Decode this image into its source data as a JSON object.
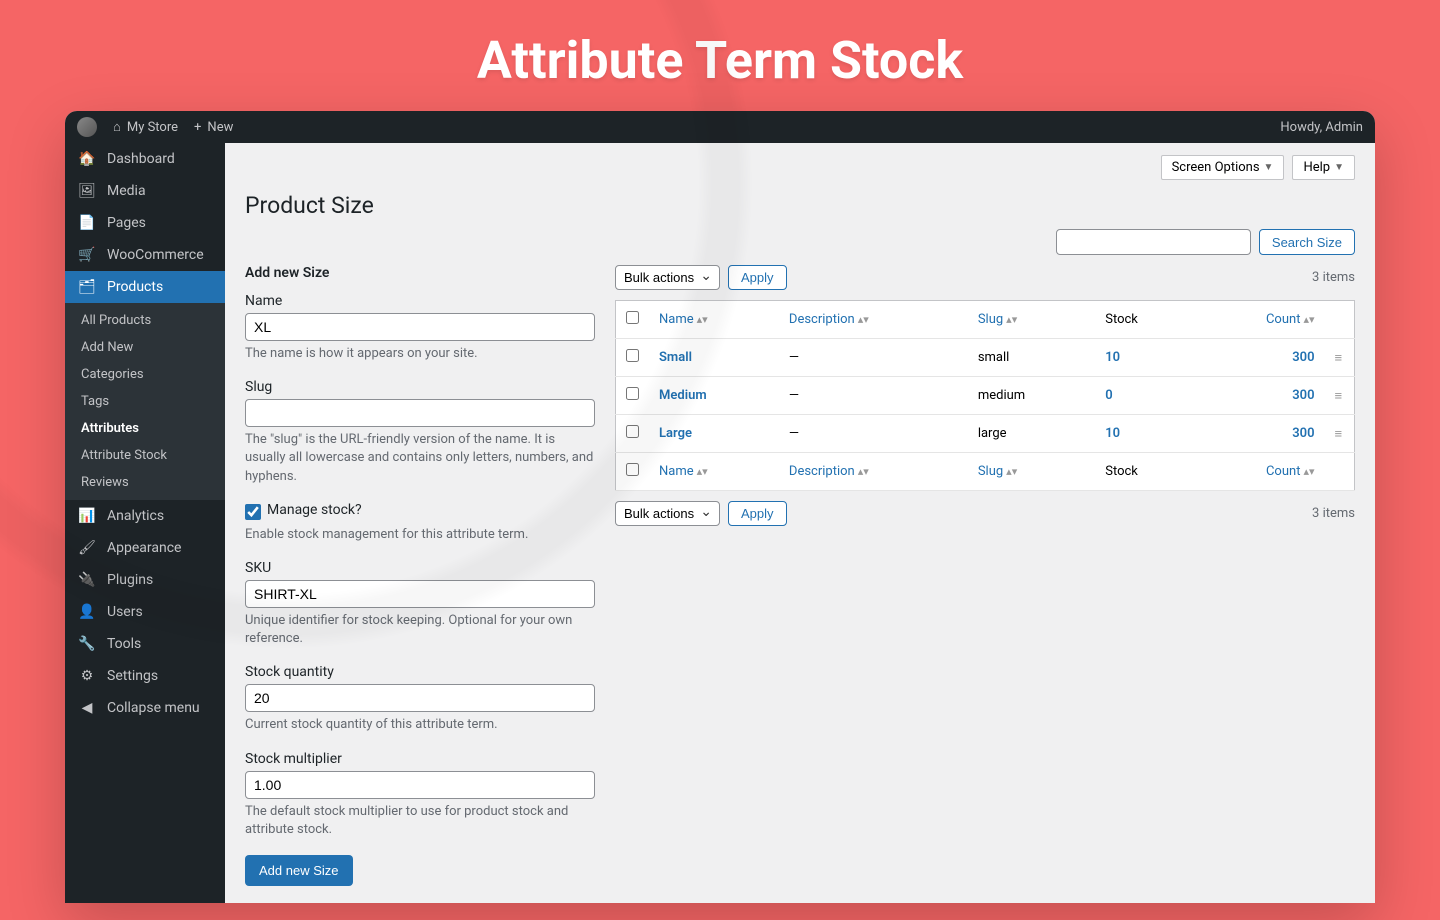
{
  "hero": "Attribute Term Stock",
  "toolbar": {
    "site": "My Store",
    "new": "New",
    "howdy": "Howdy, Admin"
  },
  "sidebar": {
    "items": [
      {
        "label": "Dashboard"
      },
      {
        "label": "Media"
      },
      {
        "label": "Pages"
      },
      {
        "label": "WooCommerce"
      },
      {
        "label": "Products"
      },
      {
        "label": "Analytics"
      },
      {
        "label": "Appearance"
      },
      {
        "label": "Plugins"
      },
      {
        "label": "Users"
      },
      {
        "label": "Tools"
      },
      {
        "label": "Settings"
      },
      {
        "label": "Collapse menu"
      }
    ],
    "sub": [
      {
        "label": "All Products"
      },
      {
        "label": "Add New"
      },
      {
        "label": "Categories"
      },
      {
        "label": "Tags"
      },
      {
        "label": "Attributes"
      },
      {
        "label": "Attribute Stock"
      },
      {
        "label": "Reviews"
      }
    ]
  },
  "top_buttons": {
    "screen_options": "Screen Options",
    "help": "Help"
  },
  "page_title": "Product Size",
  "search": {
    "button": "Search Size"
  },
  "form": {
    "heading": "Add new Size",
    "name_label": "Name",
    "name_value": "XL",
    "name_help": "The name is how it appears on your site.",
    "slug_label": "Slug",
    "slug_value": "",
    "slug_help": "The \"slug\" is the URL-friendly version of the name. It is usually all lowercase and contains only letters, numbers, and hyphens.",
    "manage_label": "Manage stock?",
    "manage_help": "Enable stock management for this attribute term.",
    "sku_label": "SKU",
    "sku_value": "SHIRT-XL",
    "sku_help": "Unique identifier for stock keeping. Optional for your own reference.",
    "qty_label": "Stock quantity",
    "qty_value": "20",
    "qty_help": "Current stock quantity of this attribute term.",
    "mult_label": "Stock multiplier",
    "mult_value": "1.00",
    "mult_help": "The default stock multiplier to use for product stock and attribute stock.",
    "submit": "Add new Size"
  },
  "table": {
    "bulk": "Bulk actions",
    "apply": "Apply",
    "items": "3 items",
    "cols": {
      "name": "Name",
      "desc": "Description",
      "slug": "Slug",
      "stock": "Stock",
      "count": "Count"
    },
    "rows": [
      {
        "name": "Small",
        "desc": "—",
        "slug": "small",
        "stock": "10",
        "count": "300"
      },
      {
        "name": "Medium",
        "desc": "—",
        "slug": "medium",
        "stock": "0",
        "count": "300"
      },
      {
        "name": "Large",
        "desc": "—",
        "slug": "large",
        "stock": "10",
        "count": "300"
      }
    ]
  }
}
